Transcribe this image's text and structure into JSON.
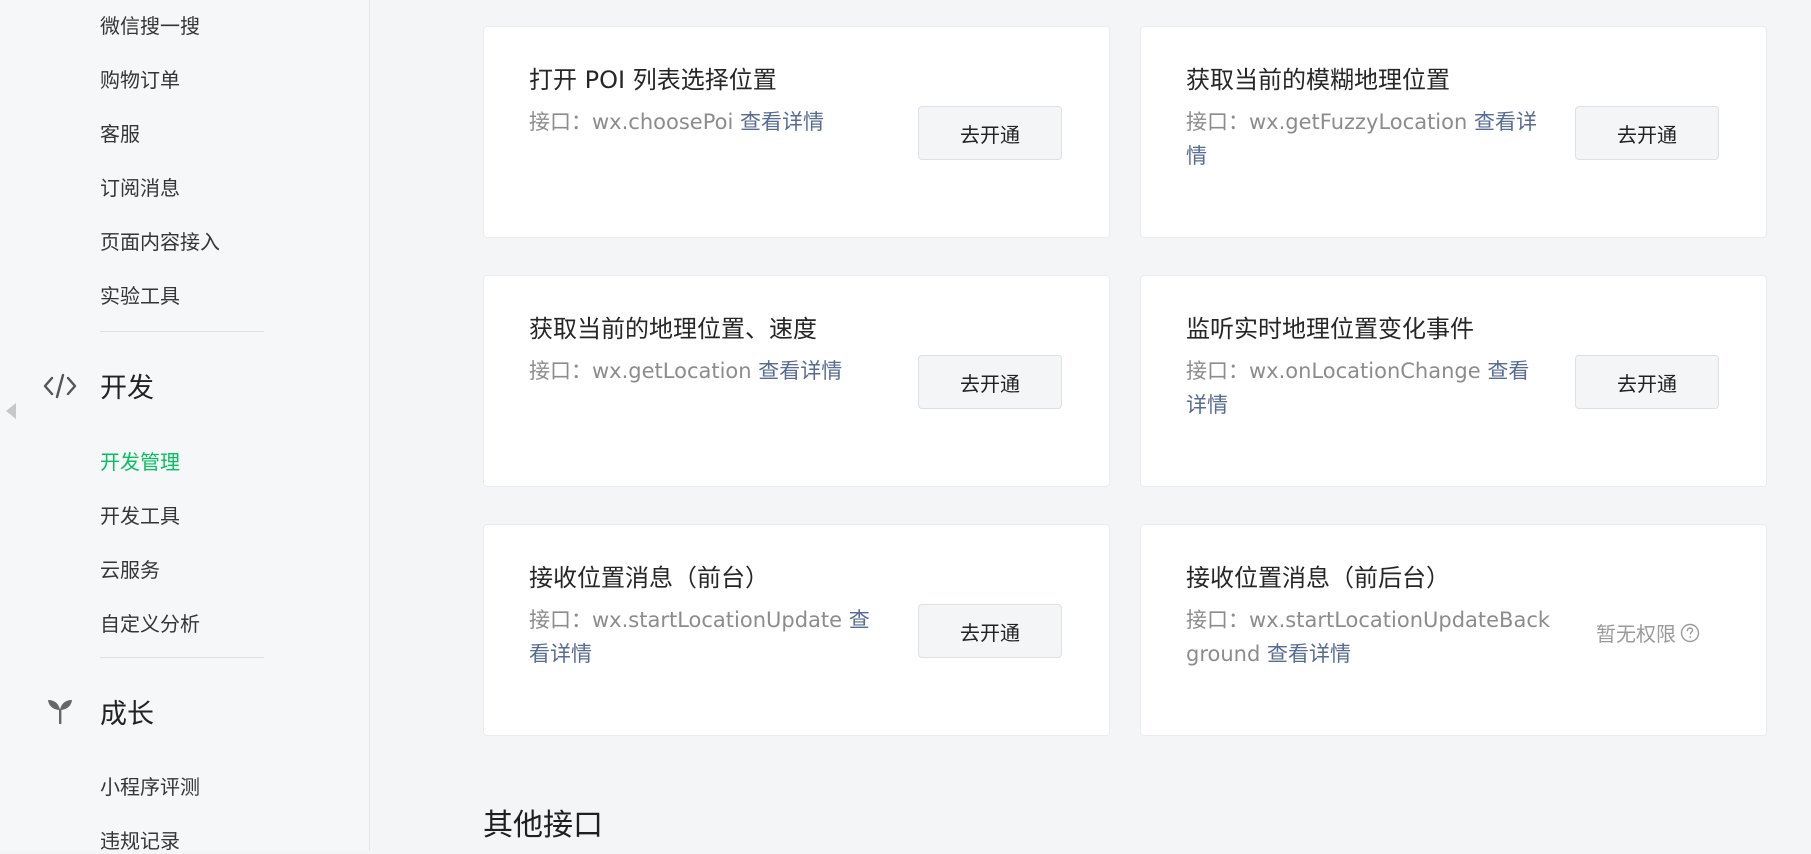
{
  "sidebar": {
    "items_top": [
      "微信搜一搜",
      "购物订单",
      "客服",
      "订阅消息",
      "页面内容接入",
      "实验工具"
    ],
    "dev_group": {
      "title": "开发",
      "icon": "code-icon",
      "items": [
        "开发管理",
        "开发工具",
        "云服务",
        "自定义分析"
      ],
      "active": "开发管理"
    },
    "growth_group": {
      "title": "成长",
      "icon": "sprout-icon",
      "items": [
        "小程序评测",
        "违规记录"
      ]
    },
    "accent_color": "#07c160"
  },
  "cards": [
    {
      "title": "打开 POI 列表选择位置",
      "desc_prefix": "接口：wx.choosePoi ",
      "link": "查看详情",
      "action": "去开通"
    },
    {
      "title": "获取当前的模糊地理位置",
      "desc_prefix": "接口：wx.getFuzzyLocation ",
      "link": "查看详情",
      "action": "去开通"
    },
    {
      "title": "获取当前的地理位置、速度",
      "desc_prefix": "接口：wx.getLocation ",
      "link": "查看详情",
      "action": "去开通"
    },
    {
      "title": "监听实时地理位置变化事件",
      "desc_prefix": "接口：wx.onLocationChange ",
      "link": "查看详情",
      "action": "去开通"
    },
    {
      "title": "接收位置消息（前台）",
      "desc_prefix": "接口：wx.startLocationUpdate ",
      "link": "查看详情",
      "action": "去开通"
    },
    {
      "title": "接收位置消息（前后台）",
      "desc_prefix": "接口：wx.startLocationUpdateBackground ",
      "link": "查看详情",
      "status": "暂无权限"
    }
  ],
  "section_title": "其他接口",
  "link_color": "#576b95"
}
